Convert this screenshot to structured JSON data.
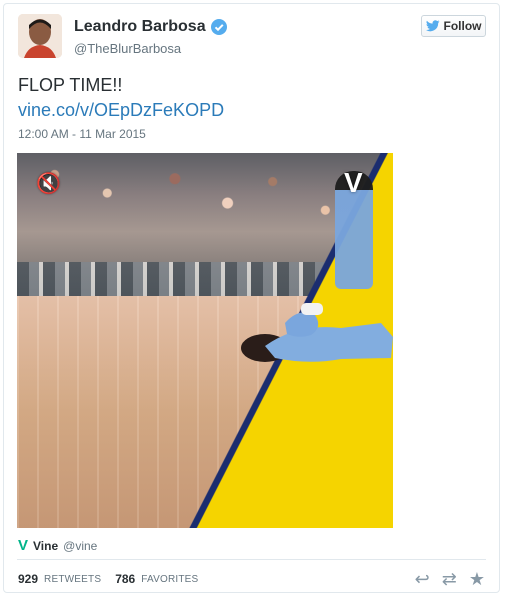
{
  "user": {
    "name": "Leandro Barbosa",
    "handle": "@TheBlurBarbosa",
    "verified_label": "Verified account"
  },
  "follow_label": "Follow",
  "tweet": {
    "text": "FLOP TIME!!",
    "link": "vine.co/v/OEpDzFeKOPD",
    "timestamp": "12:00 AM - 11 Mar 2015"
  },
  "source": {
    "name": "Vine",
    "handle": "@vine"
  },
  "stats": {
    "retweets": "929",
    "retweets_label": "RETWEETS",
    "favorites": "786",
    "favorites_label": "FAVORITES"
  },
  "icons": {
    "reply": "reply-icon",
    "retweet": "retweet-icon",
    "favorite": "favorite-icon",
    "twitter": "twitter-bird-icon",
    "mute": "mute-icon",
    "vine": "vine-icon"
  },
  "colors": {
    "twitter_blue": "#55acee",
    "link_blue": "#2b7bb9",
    "vine_green": "#00b489"
  }
}
